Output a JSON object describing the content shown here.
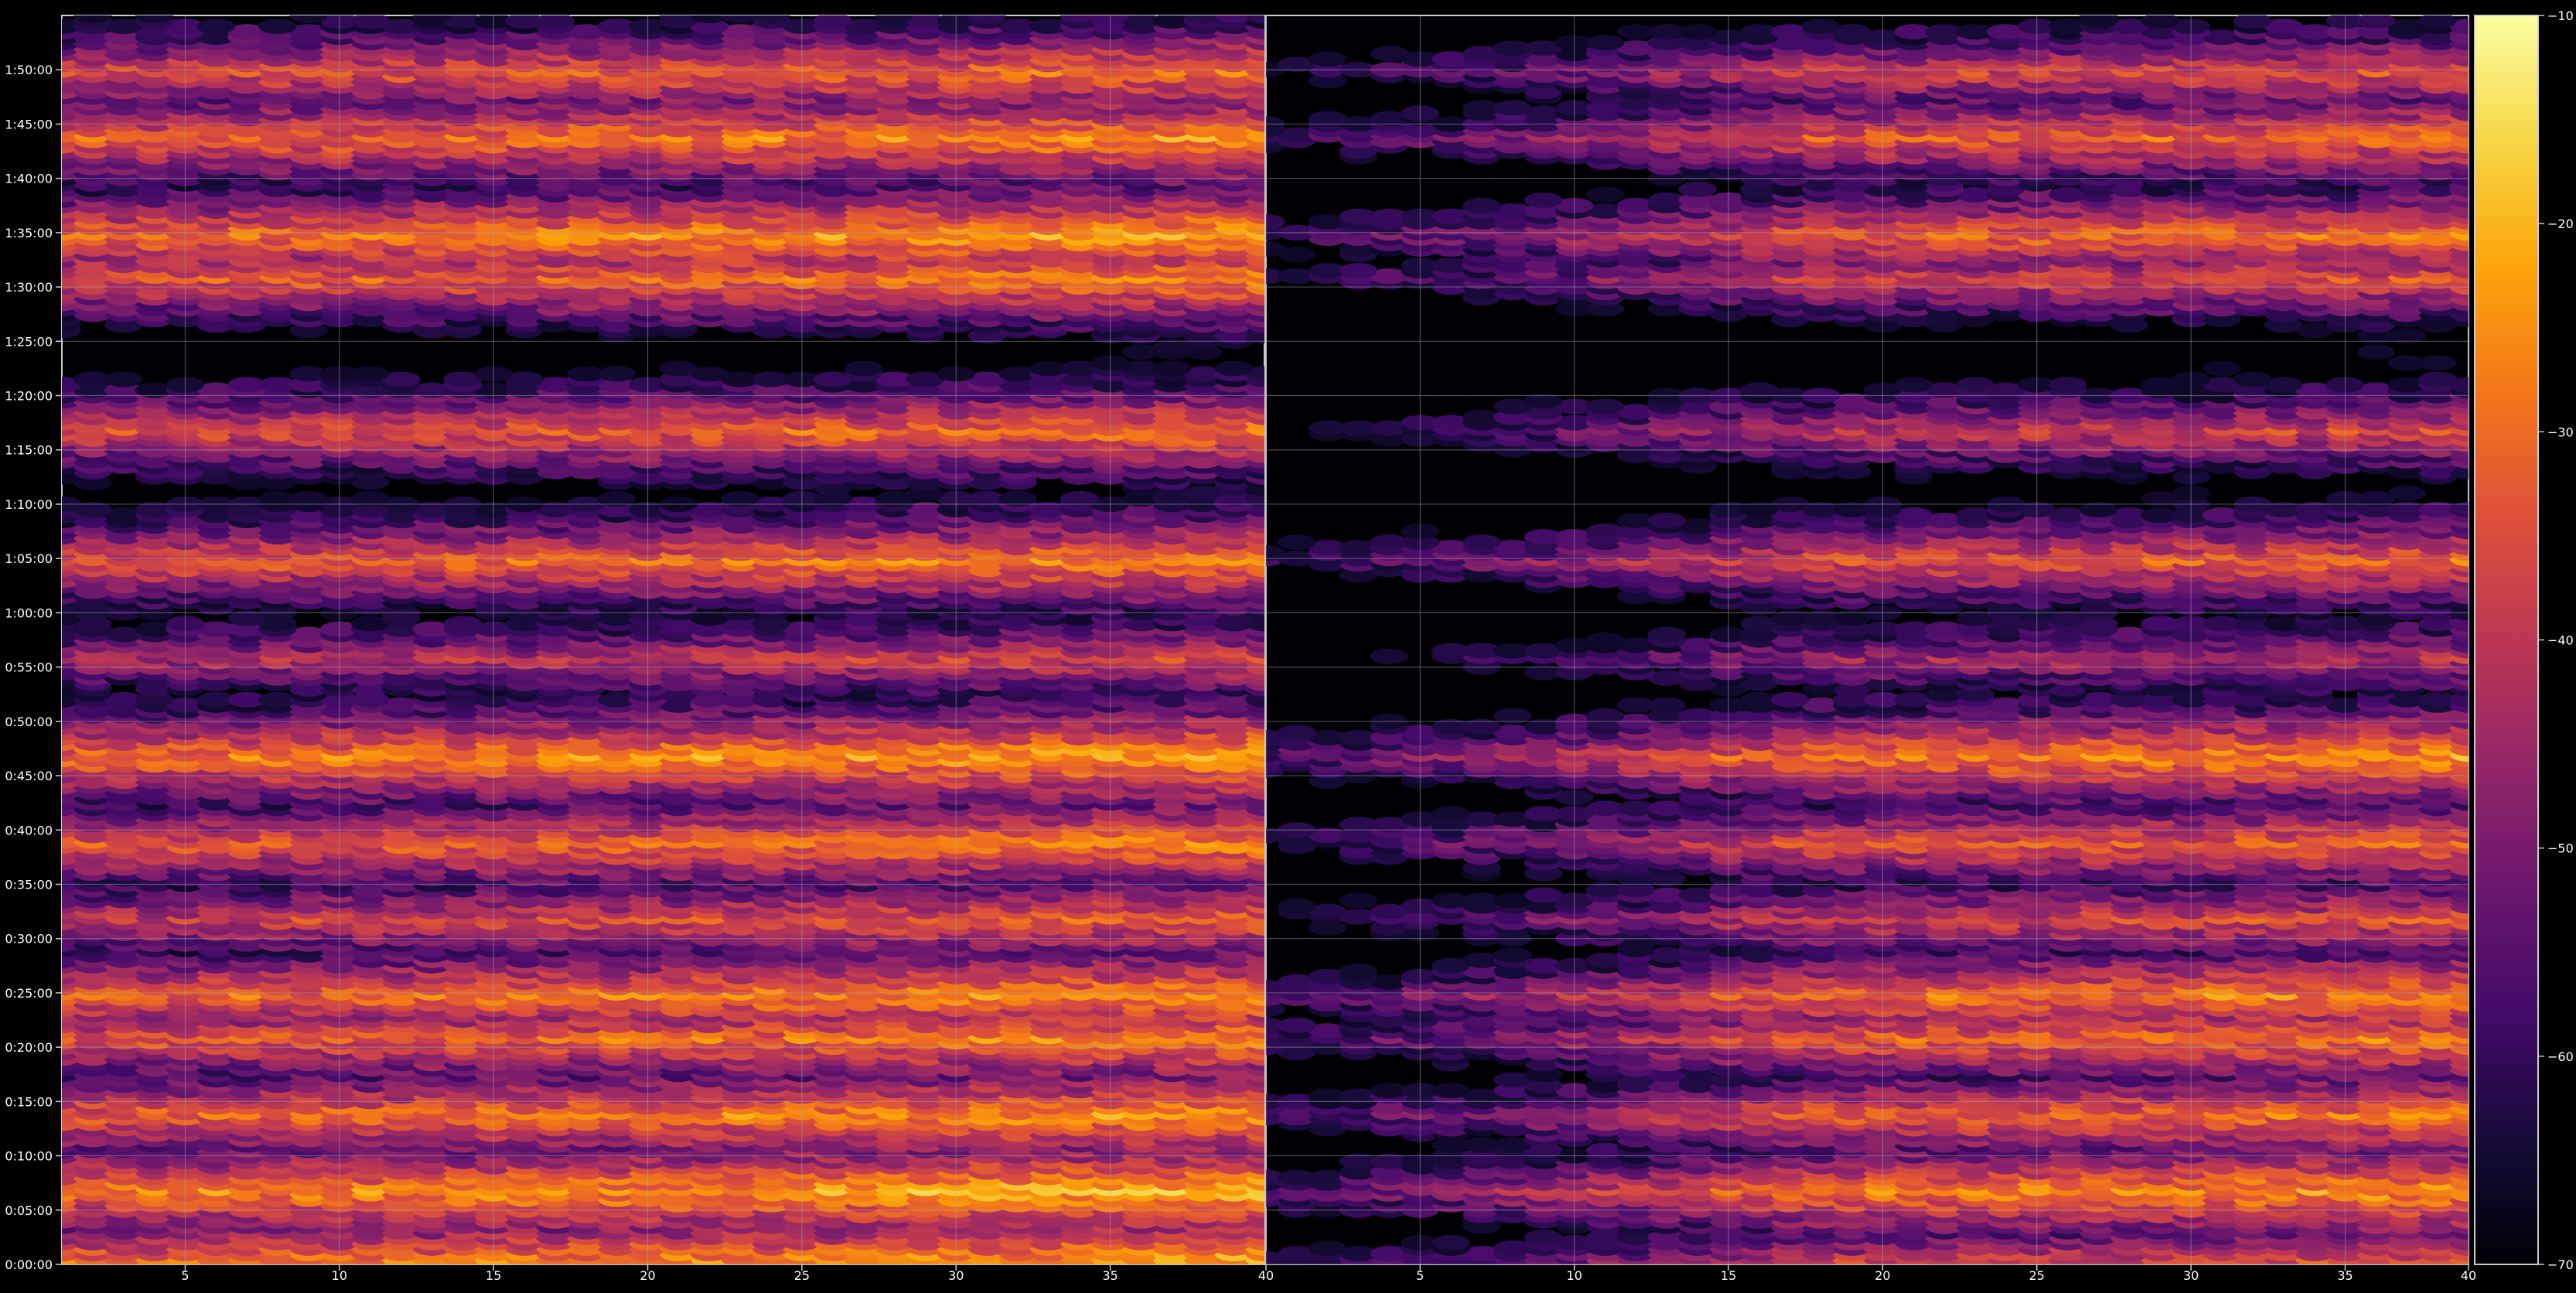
{
  "chart_data": {
    "type": "heatmap",
    "title": "",
    "xlabel": "",
    "ylabel": "",
    "panels": [
      {
        "name": "left",
        "xlim": [
          1,
          40
        ],
        "xticks": [
          5,
          10,
          15,
          20,
          25,
          30,
          35
        ],
        "xtick_labels": [
          "5",
          "10",
          "15",
          "20",
          "25",
          "30",
          "35"
        ]
      },
      {
        "name": "right",
        "xlim": [
          40,
          79
        ],
        "xticks": [
          40,
          45,
          50,
          55,
          60,
          65,
          70,
          75,
          79
        ],
        "xtick_labels": [
          "40",
          "5",
          "10",
          "15",
          "20",
          "25",
          "30",
          "35",
          "40"
        ]
      }
    ],
    "ylim_seconds": [
      0,
      6900
    ],
    "yticks_seconds": [
      0,
      300,
      600,
      900,
      1200,
      1500,
      1800,
      2100,
      2400,
      2700,
      3000,
      3300,
      3600,
      3900,
      4200,
      4500,
      4800,
      5100,
      5400,
      5700,
      6000,
      6300,
      6600
    ],
    "ytick_labels": [
      "0:00:00",
      "0:05:00",
      "0:10:00",
      "0:15:00",
      "0:20:00",
      "0:25:00",
      "0:30:00",
      "0:35:00",
      "0:40:00",
      "0:45:00",
      "0:50:00",
      "0:55:00",
      "1:00:00",
      "1:05:00",
      "1:10:00",
      "1:15:00",
      "1:20:00",
      "1:25:00",
      "1:30:00",
      "1:35:00",
      "1:40:00",
      "1:45:00",
      "1:50:00"
    ],
    "colorbar": {
      "colormap": "inferno",
      "vmin": -70,
      "vmax": -10,
      "ticks": [
        -70,
        -60,
        -50,
        -40,
        -30,
        -20,
        -10
      ],
      "tick_labels": [
        "−70",
        "−60",
        "−50",
        "−40",
        "−30",
        "−20",
        "−10"
      ]
    },
    "grid": true,
    "band_levels_dB": [
      {
        "time": "0:00:00",
        "left": -22,
        "right": -35
      },
      {
        "time": "0:07:00",
        "left": -24,
        "right": -28
      },
      {
        "time": "0:14:00",
        "left": -28,
        "right": -32
      },
      {
        "time": "0:21:00",
        "left": -30,
        "right": -32
      },
      {
        "time": "0:25:00",
        "left": -28,
        "right": -30
      },
      {
        "time": "0:32:00",
        "left": -35,
        "right": -38
      },
      {
        "time": "0:39:00",
        "left": -30,
        "right": -34
      },
      {
        "time": "0:47:00",
        "left": -25,
        "right": -28
      },
      {
        "time": "0:56:00",
        "left": -40,
        "right": -45
      },
      {
        "time": "1:05:00",
        "left": -30,
        "right": -34
      },
      {
        "time": "1:17:00",
        "left": -32,
        "right": -40
      },
      {
        "time": "1:31:00",
        "left": -30,
        "right": -38
      },
      {
        "time": "1:35:00",
        "left": -26,
        "right": -32
      },
      {
        "time": "1:44:00",
        "left": -28,
        "right": -33
      },
      {
        "time": "1:50:00",
        "left": -32,
        "right": -38
      }
    ]
  }
}
